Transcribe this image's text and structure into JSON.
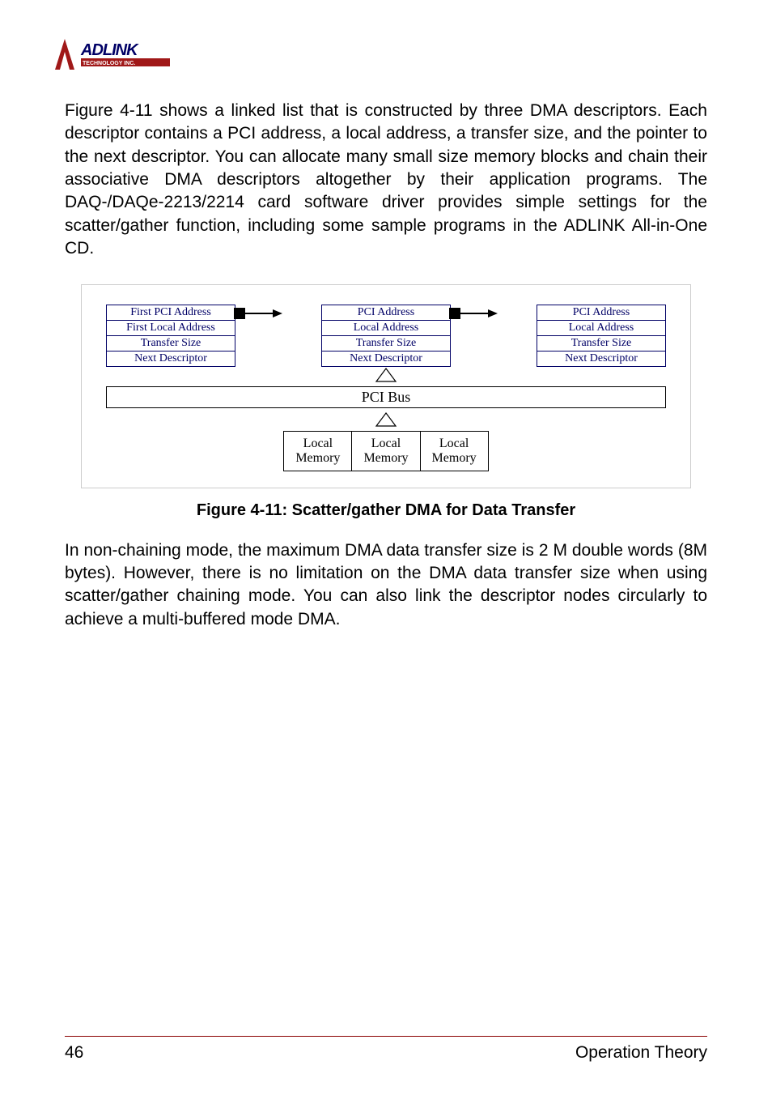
{
  "logo": {
    "name": "ADLINK",
    "sub": "TECHNOLOGY INC."
  },
  "para1": "Figure 4-11 shows a linked list that is constructed by three DMA descriptors. Each descriptor contains a PCI address, a local address, a transfer size, and the pointer to the next descriptor. You can allocate many small size memory blocks and chain their associative DMA descriptors altogether by their application programs. The DAQ-/DAQe-2213/2214 card software driver provides simple settings for the scatter/gather function, including some sample programs in the ADLINK All-in-One CD.",
  "figure": {
    "block1": {
      "r1": "First PCI Address",
      "r2": "First Local Address",
      "r3": "Transfer Size",
      "r4": "Next Descriptor"
    },
    "block2": {
      "r1": "PCI Address",
      "r2": "Local Address",
      "r3": "Transfer Size",
      "r4": "Next Descriptor"
    },
    "block3": {
      "r1": "PCI Address",
      "r2": "Local Address",
      "r3": "Transfer Size",
      "r4": "Next Descriptor"
    },
    "bus": "PCI Bus",
    "mem1": {
      "l1": "Local",
      "l2": "Memory"
    },
    "mem2": {
      "l1": "Local",
      "l2": "Memory"
    },
    "mem3": {
      "l1": "Local",
      "l2": "Memory"
    }
  },
  "caption": "Figure 4-11: Scatter/gather DMA for Data Transfer",
  "para2": "In non-chaining mode, the maximum DMA data transfer size is 2 M double words (8M bytes). However, there is no limitation on the DMA data transfer size when using scatter/gather chaining mode. You can also link the descriptor nodes circularly to achieve a multi-buffered mode DMA.",
  "footer": {
    "page": "46",
    "section": "Operation Theory"
  }
}
